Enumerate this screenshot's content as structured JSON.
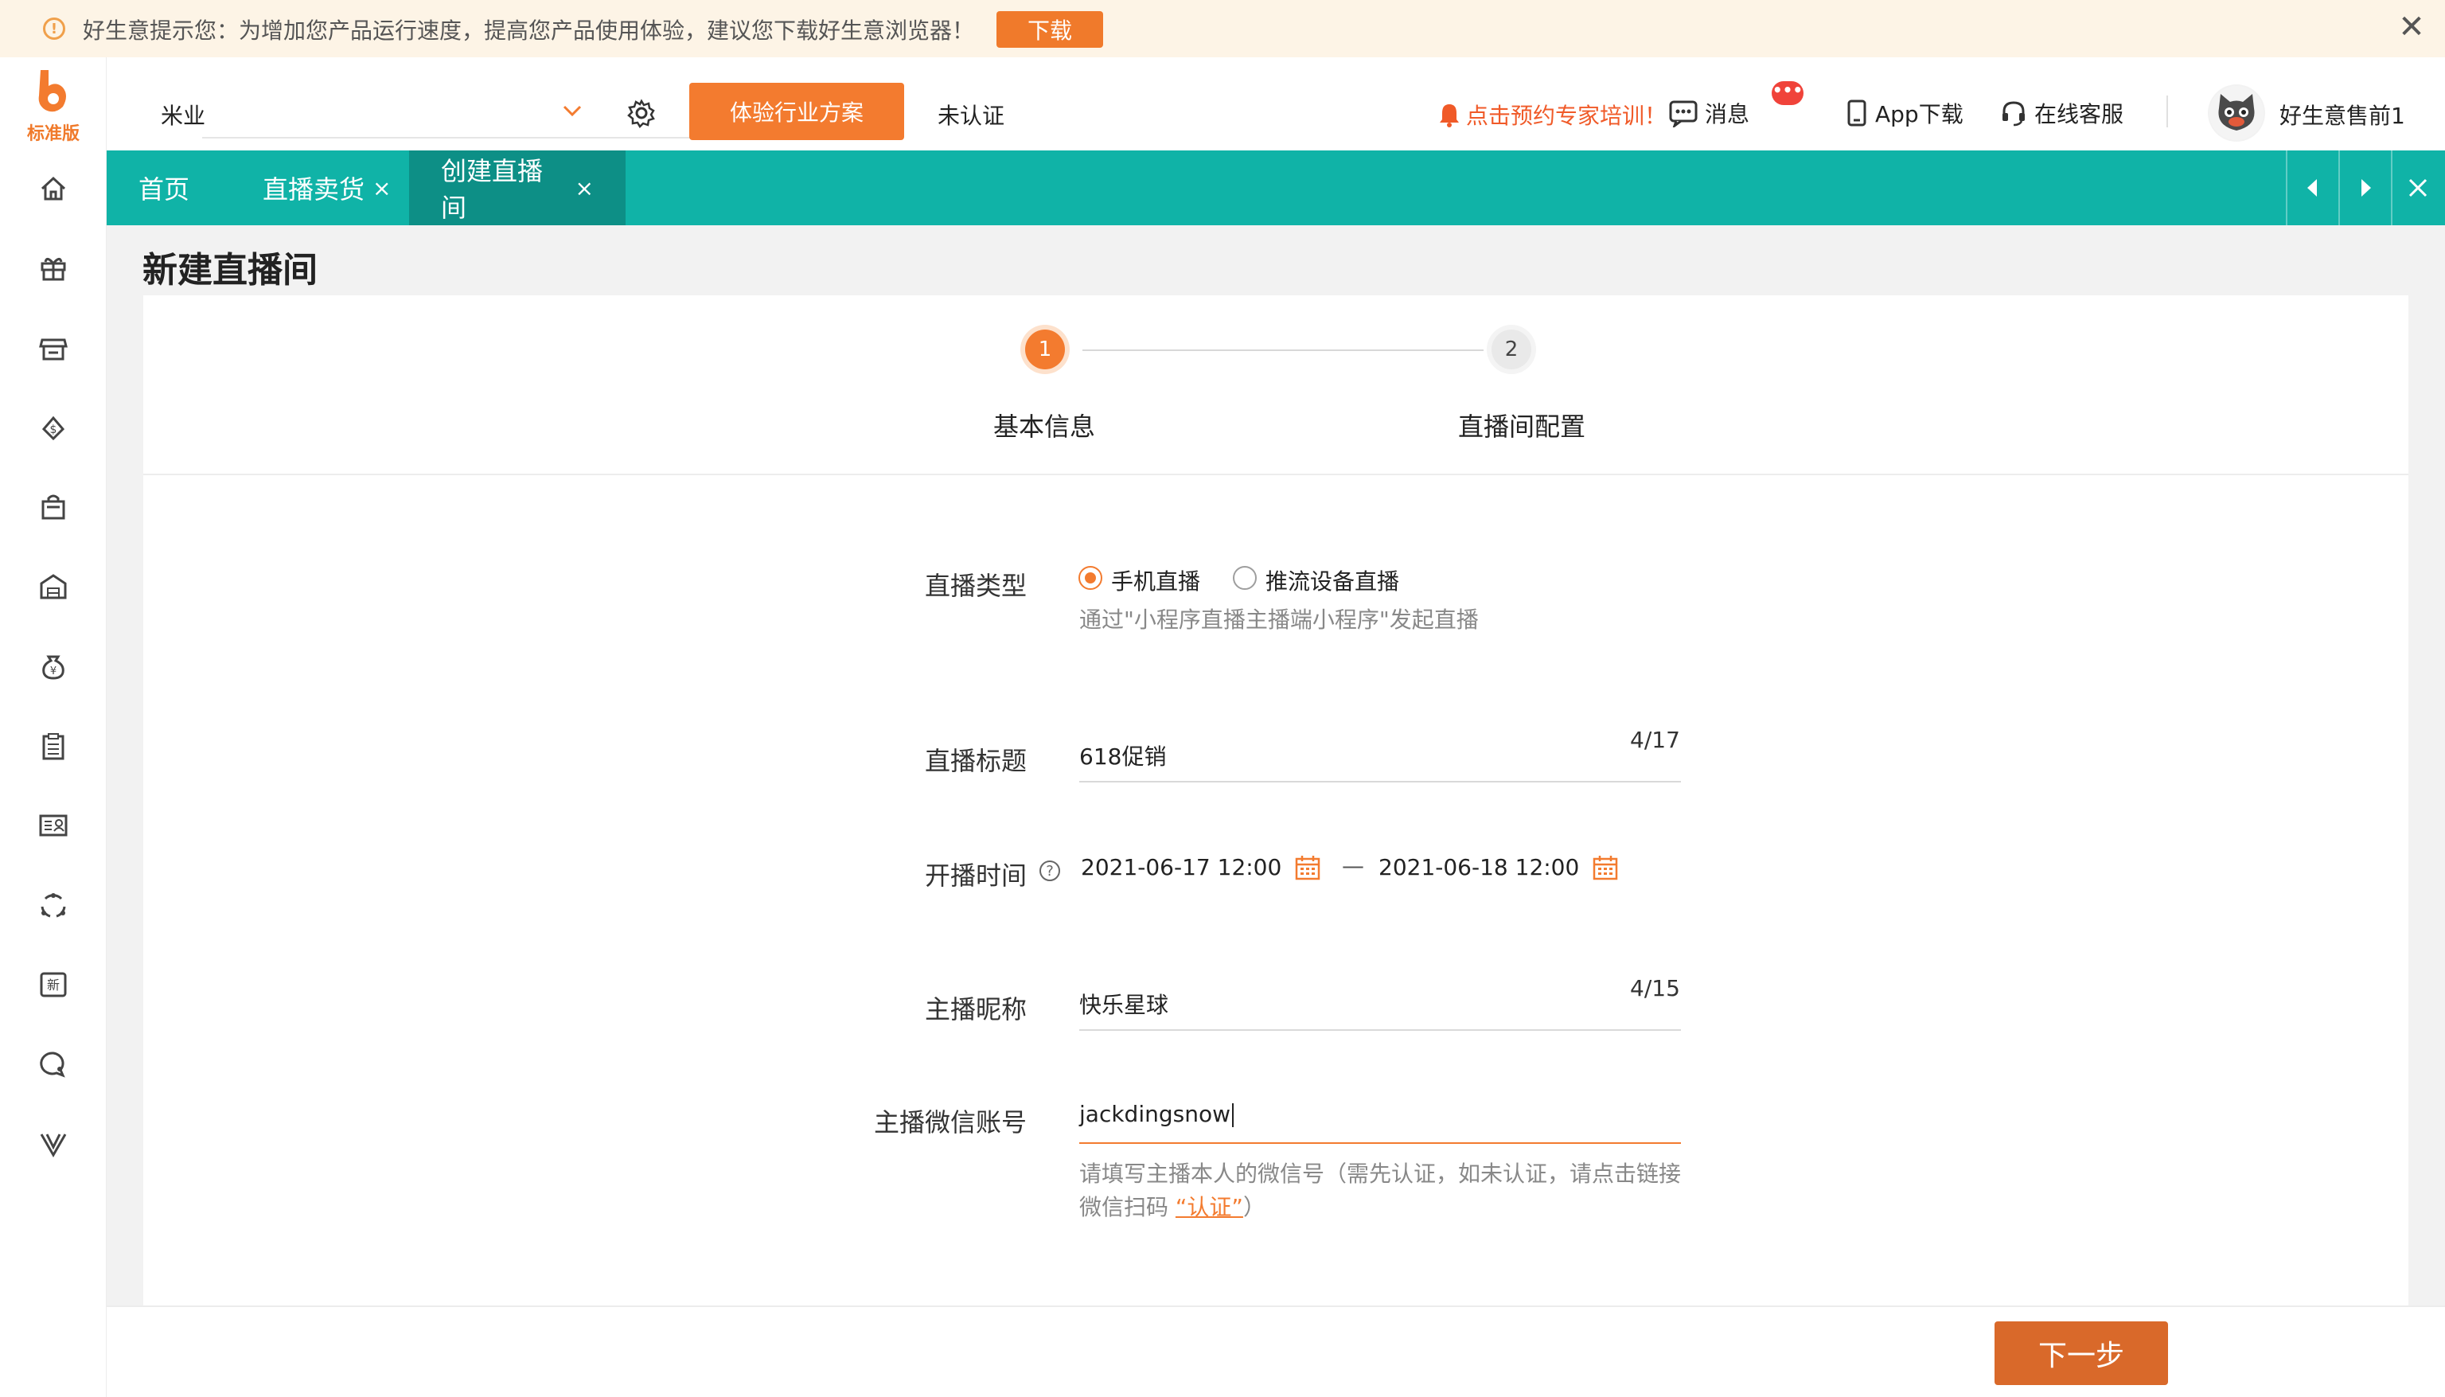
{
  "notice": {
    "text": "好生意提示您：为增加您产品运行速度，提高您产品使用体验，建议您下载好生意浏览器！",
    "download_label": "下载",
    "close_label": "✕"
  },
  "logo": {
    "edition": "标准版"
  },
  "header": {
    "company": "米业",
    "solution_label": "体验行业方案",
    "uncertified_label": "未认证",
    "promo_label": "点击预约专家培训！",
    "messages_label": "消息",
    "messages_badge": "•••",
    "app_download_label": "App下载",
    "online_service_label": "在线客服",
    "username": "好生意售前1"
  },
  "tabs": [
    {
      "label": "首页",
      "closable": false
    },
    {
      "label": "直播卖货",
      "closable": true,
      "close": "×"
    },
    {
      "label": "创建直播间",
      "closable": true,
      "close": "×",
      "active": true
    }
  ],
  "page": {
    "title": "新建直播间"
  },
  "stepper": {
    "steps": [
      {
        "number": "1",
        "label": "基本信息",
        "active": true
      },
      {
        "number": "2",
        "label": "直播间配置",
        "active": false
      }
    ]
  },
  "form": {
    "live_type": {
      "label": "直播类型",
      "options": [
        {
          "label": "手机直播",
          "checked": true
        },
        {
          "label": "推流设备直播",
          "checked": false
        }
      ],
      "hint": "通过\"小程序直播主播端小程序\"发起直播"
    },
    "title": {
      "label": "直播标题",
      "value": "618促销",
      "count": "4/17"
    },
    "start_time": {
      "label": "开播时间",
      "help": "?",
      "start": "2021-06-17 12:00",
      "separator": "—",
      "end": "2021-06-18 12:00"
    },
    "anchor_nickname": {
      "label": "主播昵称",
      "value": "快乐星球",
      "count": "4/15"
    },
    "anchor_wechat": {
      "label": "主播微信账号",
      "value": "jackdingsnow",
      "hint_line1": "请填写主播本人的微信号（需先认证，如未认证，请点击链接",
      "hint_line2_prefix": "微信扫码",
      "hint_link": "“认证”",
      "hint_line2_suffix": "）"
    }
  },
  "footer": {
    "next_label": "下一步"
  },
  "colors": {
    "accent": "#f37b2f",
    "teal": "#10b3a7",
    "teal_dark": "#0d8f86",
    "promo": "#f05a28"
  },
  "icons": {
    "sidebar": [
      "home-icon",
      "gift-icon",
      "store-icon",
      "money-bag-icon",
      "shopping-bag-icon",
      "warehouse-icon",
      "yuan-bag-icon",
      "clipboard-icon",
      "id-card-icon",
      "customer-loop-icon",
      "new-icon",
      "chat-search-icon",
      "vip-icon"
    ]
  }
}
